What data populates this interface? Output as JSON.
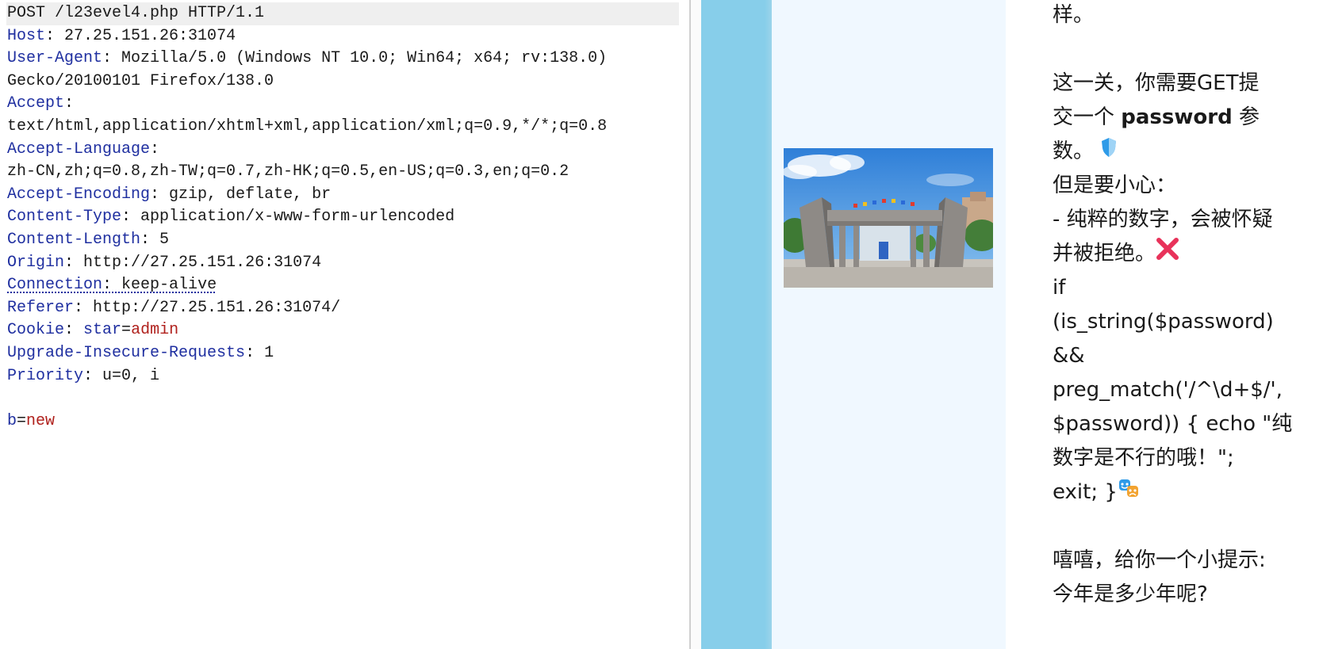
{
  "request": {
    "request_line": "POST /l23evel4.php HTTP/1.1",
    "headers": [
      {
        "key": "Host",
        "value": "27.25.151.26:31074"
      },
      {
        "key": "User-Agent",
        "value": "Mozilla/5.0 (Windows NT 10.0; Win64; x64; rv:138.0)",
        "value_cont": "Gecko/20100101 Firefox/138.0"
      },
      {
        "key": "Accept",
        "value": "",
        "value_cont": "text/html,application/xhtml+xml,application/xml;q=0.9,*/*;q=0.8"
      },
      {
        "key": "Accept-Language",
        "value": "",
        "value_cont": "zh-CN,zh;q=0.8,zh-TW;q=0.7,zh-HK;q=0.5,en-US;q=0.3,en;q=0.2"
      },
      {
        "key": "Accept-Encoding",
        "value": "gzip, deflate, br"
      },
      {
        "key": "Content-Type",
        "value": "application/x-www-form-urlencoded"
      },
      {
        "key": "Content-Length",
        "value": "5"
      },
      {
        "key": "Origin",
        "value": "http://27.25.151.26:31074"
      },
      {
        "key": "Connection",
        "value": "keep-alive"
      },
      {
        "key": "Referer",
        "value": "http://27.25.151.26:31074/"
      },
      {
        "key": "Cookie",
        "value": "",
        "cookie_name": "star",
        "cookie_value": "admin"
      },
      {
        "key": "Upgrade-Insecure-Requests",
        "value": "1"
      },
      {
        "key": "Priority",
        "value": "u=0, i"
      }
    ],
    "body": {
      "param": "b",
      "value": "new"
    }
  },
  "page": {
    "hint_lines": [
      "样。",
      "",
      "这一关，你需要GET提",
      "交一个 ",
      "数。",
      "但是要小心：",
      "- 纯粹的数字，会被怀疑",
      "并被拒绝。",
      "if",
      "(is_string($password)",
      "&&",
      "preg_match('/^\\d+$/',",
      "$password)) { echo \"纯",
      "数字是不行的哦！\";",
      "exit; }",
      "",
      "嘻嘻，给你一个小提示:",
      "今年是多少年呢?"
    ],
    "bold_word": "password",
    "after_bold": " 参",
    "icons": [
      "shield-icon",
      "cross-mark-icon",
      "performing-arts-icon"
    ],
    "colors": {
      "sidebar_blue": "#87ceea",
      "pale_bg": "#f0f8ff",
      "cross_red": "#e8325a",
      "header_key_blue": "#1f2fa0",
      "value_red": "#b0211d"
    }
  }
}
